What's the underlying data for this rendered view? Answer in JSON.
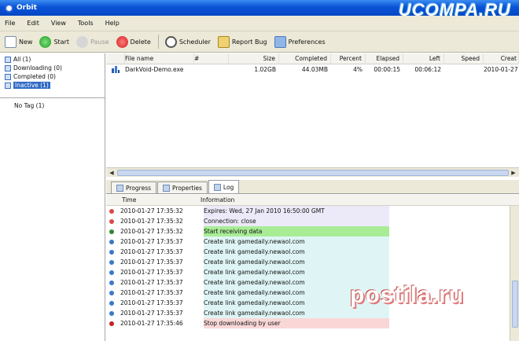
{
  "window": {
    "title": "Orbit"
  },
  "watermarks": {
    "top": "UCOMPA.RU",
    "bottom": "postila.ru"
  },
  "menu": [
    "File",
    "Edit",
    "View",
    "Tools",
    "Help"
  ],
  "toolbar": {
    "new": "New",
    "start": "Start",
    "pause": "Pause",
    "delete": "Delete",
    "scheduler": "Scheduler",
    "report_bug": "Report Bug",
    "preferences": "Preferences"
  },
  "sidebar": {
    "categories": [
      {
        "label": "All (1)",
        "selected": false
      },
      {
        "label": "Downloading (0)",
        "selected": false
      },
      {
        "label": "Completed (0)",
        "selected": false
      },
      {
        "label": "Inactive (1)",
        "selected": true
      }
    ],
    "no_tag": "No Tag (1)"
  },
  "downloads": {
    "columns": [
      "File name",
      "#",
      "Size",
      "Completed",
      "Percent",
      "Elapsed",
      "Left",
      "Speed",
      "Creat"
    ],
    "rows": [
      {
        "name": "DarkVoid-Demo.exe",
        "num": "",
        "size": "1.02GB",
        "completed": "44.03MB",
        "percent": "4%",
        "elapsed": "00:00:15",
        "left": "00:06:12",
        "speed": "",
        "created": "2010-01-27"
      }
    ]
  },
  "tabs": [
    "Progress",
    "Properties",
    "Log"
  ],
  "log": {
    "columns": [
      "Time",
      "Information"
    ],
    "rows": [
      {
        "time": "2010-01-27 17:35:32",
        "info": "Expires: Wed, 27 Jan 2010 16:50:00 GMT",
        "type": "info"
      },
      {
        "time": "2010-01-27 17:35:32",
        "info": "Connection: close",
        "type": "info"
      },
      {
        "time": "2010-01-27 17:35:32",
        "info": "Start receiving data",
        "type": "success"
      },
      {
        "time": "2010-01-27 17:35:37",
        "info": "Create link gamedaily.newaol.com",
        "type": "link"
      },
      {
        "time": "2010-01-27 17:35:37",
        "info": "Create link gamedaily.newaol.com",
        "type": "link"
      },
      {
        "time": "2010-01-27 17:35:37",
        "info": "Create link gamedaily.newaol.com",
        "type": "link"
      },
      {
        "time": "2010-01-27 17:35:37",
        "info": "Create link gamedaily.newaol.com",
        "type": "link"
      },
      {
        "time": "2010-01-27 17:35:37",
        "info": "Create link gamedaily.newaol.com",
        "type": "link"
      },
      {
        "time": "2010-01-27 17:35:37",
        "info": "Create link gamedaily.newaol.com",
        "type": "link"
      },
      {
        "time": "2010-01-27 17:35:37",
        "info": "Create link gamedaily.newaol.com",
        "type": "link"
      },
      {
        "time": "2010-01-27 17:35:37",
        "info": "Create link gamedaily.newaol.com",
        "type": "link"
      },
      {
        "time": "2010-01-27 17:35:46",
        "info": "Stop downloading by user",
        "type": "error"
      }
    ]
  },
  "colors": {
    "info_bg": "#ece9f8",
    "success_bg": "#a8ec96",
    "link_bg": "#dff5f5",
    "error_bg": "#f9d7d7",
    "selection": "#316ac5"
  }
}
